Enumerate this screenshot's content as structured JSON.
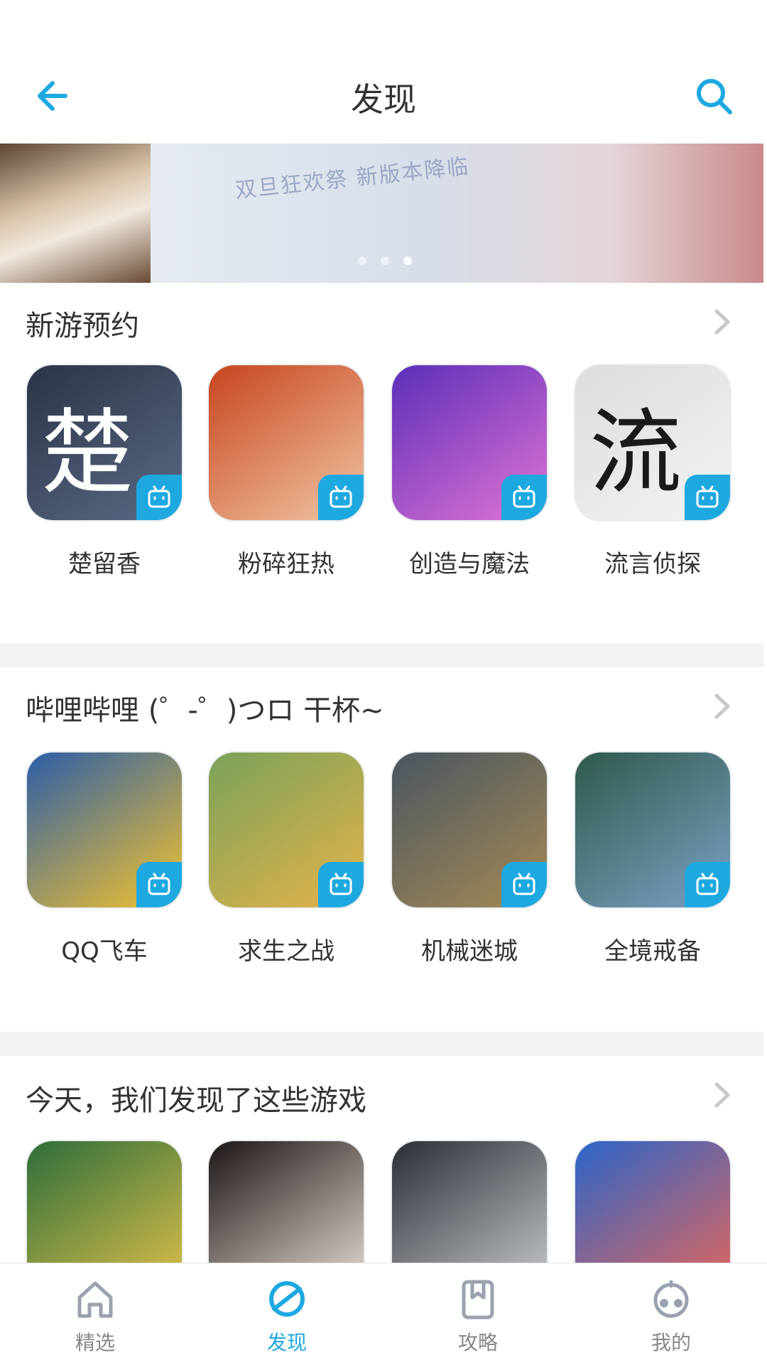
{
  "header": {
    "title": "发现"
  },
  "banner": {
    "text": "双旦狂欢祭 新版本降临",
    "dots": 3,
    "active_dot": 2
  },
  "sections": [
    {
      "title": "新游预约",
      "games": [
        {
          "name": "楚留香",
          "colors": [
            "#2b3446",
            "#5a6a86"
          ],
          "glyph": "楚"
        },
        {
          "name": "粉碎狂热",
          "colors": [
            "#c6451f",
            "#f2c6a3"
          ],
          "glyph": ""
        },
        {
          "name": "创造与魔法",
          "colors": [
            "#5b2fb8",
            "#e173d6"
          ],
          "glyph": ""
        },
        {
          "name": "流言侦探",
          "colors": [
            "#dcdcdc",
            "#f4f4f4"
          ],
          "glyph": "流"
        }
      ]
    },
    {
      "title": "哔哩哔哩 (゜-゜)つロ 干杯~",
      "games": [
        {
          "name": "QQ飞车",
          "colors": [
            "#2c5ea8",
            "#f3c22e"
          ],
          "glyph": ""
        },
        {
          "name": "求生之战",
          "colors": [
            "#7aa25a",
            "#e5b34a"
          ],
          "glyph": ""
        },
        {
          "name": "机械迷城",
          "colors": [
            "#4a5661",
            "#a58a55"
          ],
          "glyph": ""
        },
        {
          "name": "全境戒备",
          "colors": [
            "#2f5a4c",
            "#7aa2c4"
          ],
          "glyph": ""
        }
      ]
    },
    {
      "title": "今天，我们发现了这些游戏",
      "games": [
        {
          "name": "",
          "colors": [
            "#2d6e3a",
            "#e0c04a"
          ],
          "glyph": ""
        },
        {
          "name": "",
          "colors": [
            "#1c1616",
            "#e9e0d6"
          ],
          "glyph": ""
        },
        {
          "name": "",
          "colors": [
            "#2a2f35",
            "#c9ccd0"
          ],
          "glyph": ""
        },
        {
          "name": "",
          "colors": [
            "#2b65c9",
            "#e6665a"
          ],
          "glyph": ""
        }
      ]
    }
  ],
  "tabs": [
    {
      "label": "精选",
      "icon": "home-icon",
      "active": false
    },
    {
      "label": "发现",
      "icon": "planet-icon",
      "active": true
    },
    {
      "label": "攻略",
      "icon": "book-icon",
      "active": false
    },
    {
      "label": "我的",
      "icon": "controller-icon",
      "active": false
    }
  ],
  "colors": {
    "accent": "#1ea8e0",
    "text": "#333333",
    "divider": "#f2f3f5"
  }
}
